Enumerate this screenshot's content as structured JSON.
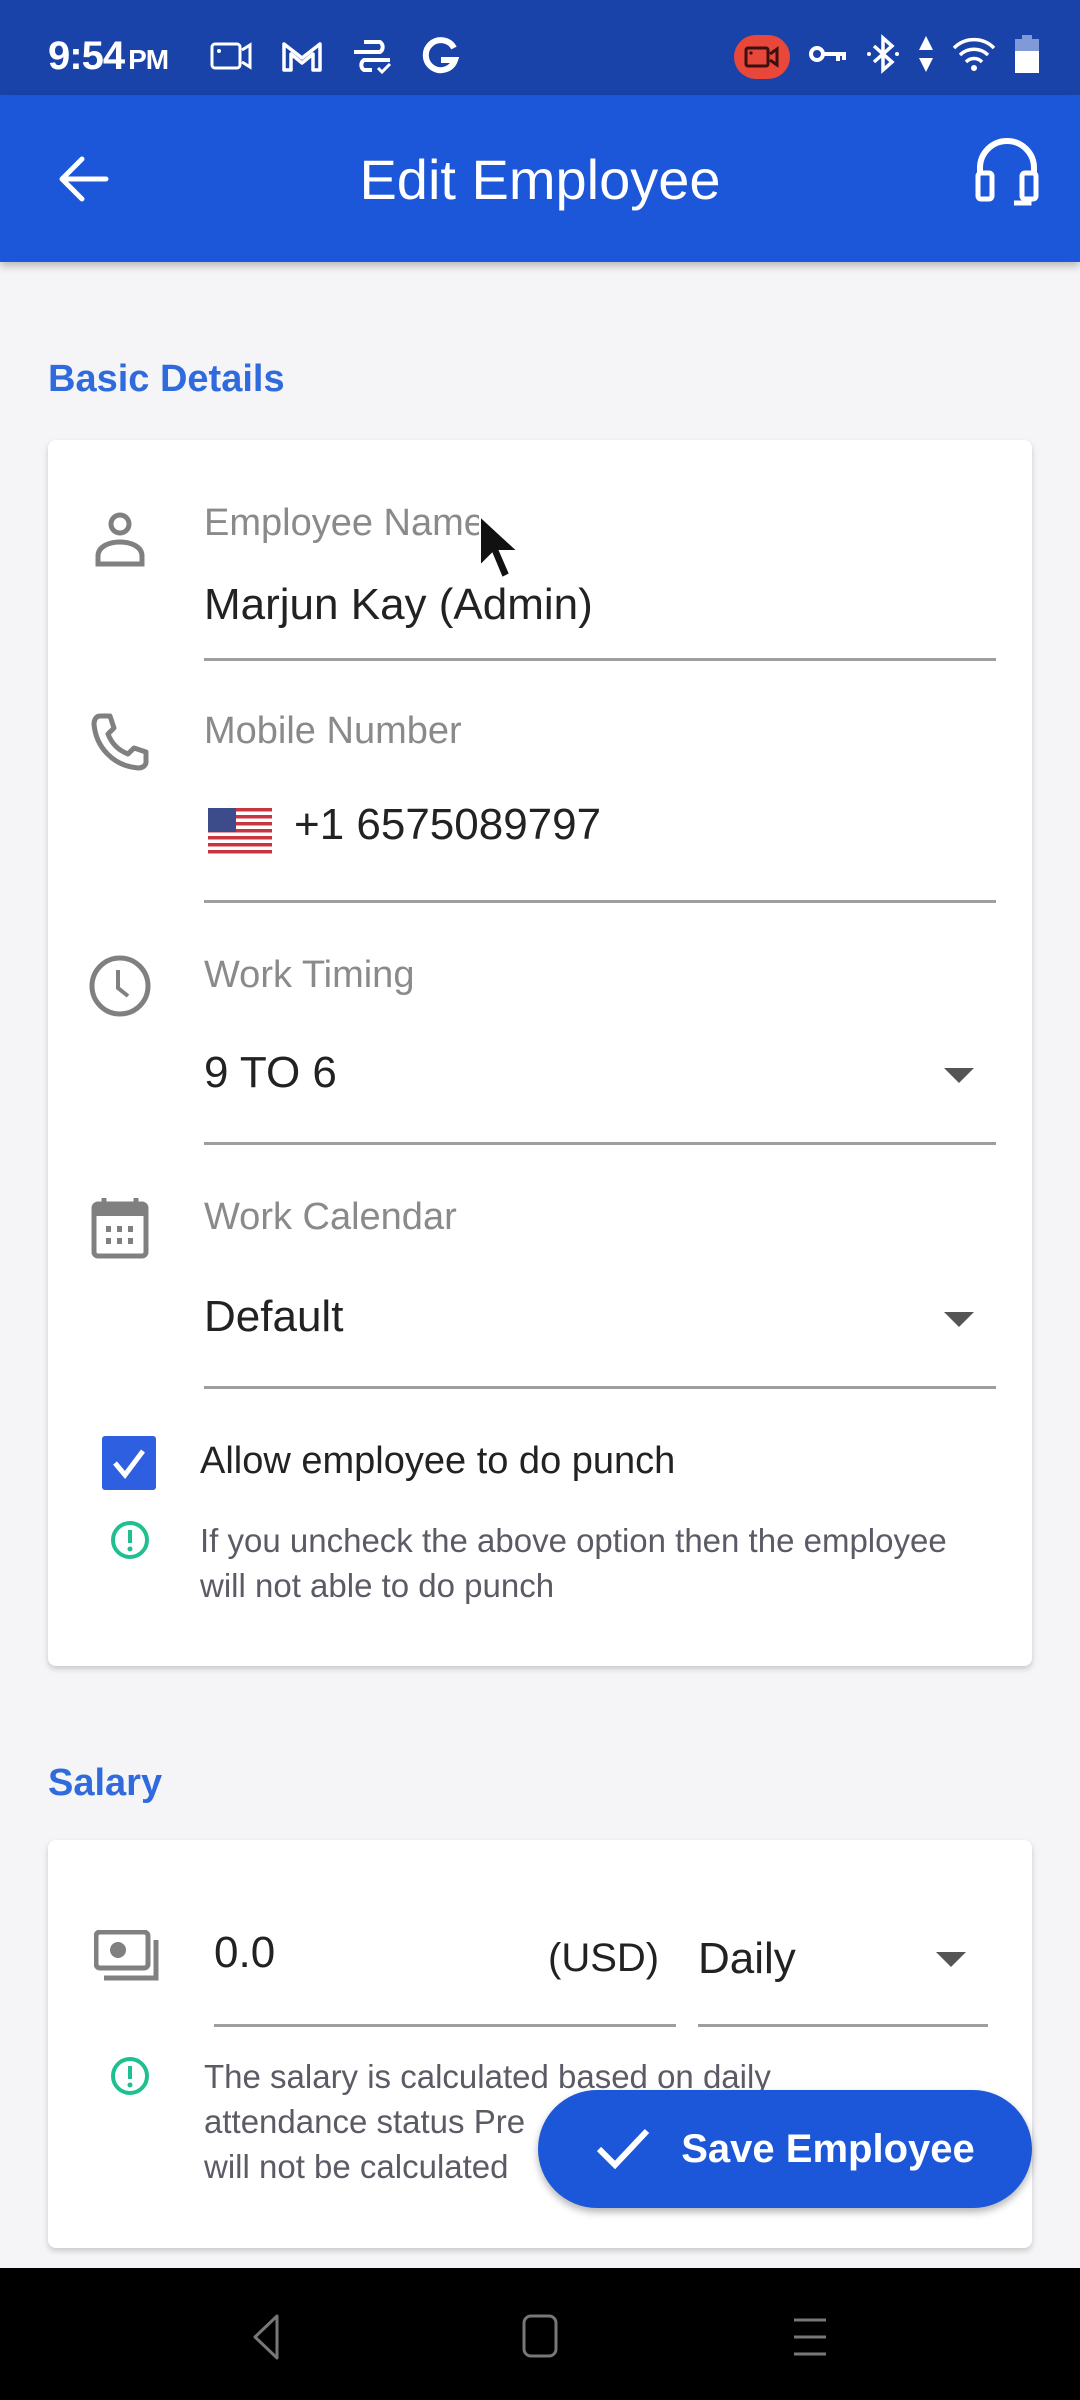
{
  "status_bar": {
    "time": "9:54",
    "ampm": "PM",
    "left_icons": [
      "video-call-icon",
      "gmail-icon",
      "sync-app-icon",
      "google-icon"
    ],
    "right_icons": [
      "screen-record-icon",
      "vpn-key-icon",
      "bluetooth-icon",
      "data-arrows-icon",
      "wifi-icon",
      "battery-icon"
    ]
  },
  "app_bar": {
    "title": "Edit Employee",
    "back_icon": "arrow-left-icon",
    "action_icon": "headset-icon"
  },
  "basic_details": {
    "section_title": "Basic Details",
    "employee_name": {
      "label": "Employee Name",
      "value": "Marjun Kay (Admin)",
      "icon": "person-icon"
    },
    "mobile_number": {
      "label": "Mobile Number",
      "country_flag": "us-flag",
      "value": "+1 6575089797",
      "icon": "phone-icon"
    },
    "work_timing": {
      "label": "Work Timing",
      "value": "9 TO 6",
      "icon": "clock-icon"
    },
    "work_calendar": {
      "label": "Work Calendar",
      "value": "Default",
      "icon": "calendar-icon"
    },
    "allow_punch": {
      "label": "Allow employee to do punch",
      "checked": true
    },
    "punch_info": "If you uncheck the above option then the employee will not able to do punch"
  },
  "salary": {
    "section_title": "Salary",
    "amount": "0.0",
    "currency": "(USD)",
    "period": "Daily",
    "info_line1": "The salary is calculated based on daily",
    "info_line2": "attendance status Pre",
    "info_line3": "will not be calculated"
  },
  "save_button": {
    "label": "Save Employee"
  },
  "nav_bar": {
    "buttons": [
      "back",
      "home",
      "recents"
    ]
  },
  "colors": {
    "primary": "#1c56d9",
    "status_bar": "#1a43a9",
    "section_title": "#2f6bdc",
    "info_icon": "#1fbf8f",
    "checkbox": "#2d5fe0"
  }
}
